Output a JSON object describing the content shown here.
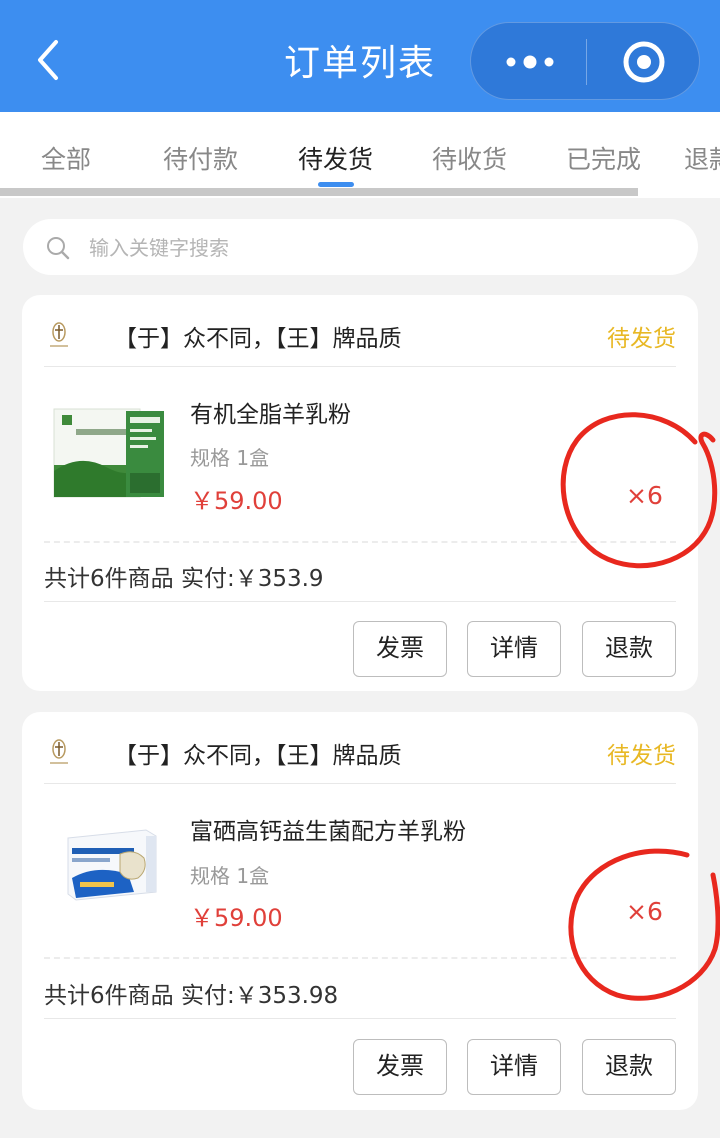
{
  "header": {
    "title": "订单列表"
  },
  "tabs": [
    {
      "label": "全部"
    },
    {
      "label": "待付款"
    },
    {
      "label": "待发货"
    },
    {
      "label": "待收货"
    },
    {
      "label": "已完成"
    },
    {
      "label": "退款"
    }
  ],
  "search": {
    "placeholder": "输入关键字搜索",
    "value": ""
  },
  "orders": [
    {
      "shop_name": "【于】众不同，【王】牌品质",
      "status": "待发货",
      "product_name": "有机全脂羊乳粉",
      "spec": "规格 1盒",
      "price": "￥59.00",
      "quantity": "×6",
      "summary": "共计6件商品 实付:￥353.9",
      "buttons": {
        "invoice": "发票",
        "detail": "详情",
        "refund": "退款"
      }
    },
    {
      "shop_name": "【于】众不同，【王】牌品质",
      "status": "待发货",
      "product_name": "富硒高钙益生菌配方羊乳粉",
      "spec": "规格 1盒",
      "price": "￥59.00",
      "quantity": "×6",
      "summary": "共计6件商品 实付:￥353.98",
      "buttons": {
        "invoice": "发票",
        "detail": "详情",
        "refund": "退款"
      }
    }
  ],
  "colors": {
    "primary": "#3d8ef0",
    "status": "#e8b825",
    "price": "#e0403a",
    "annotation": "#e8281e"
  }
}
